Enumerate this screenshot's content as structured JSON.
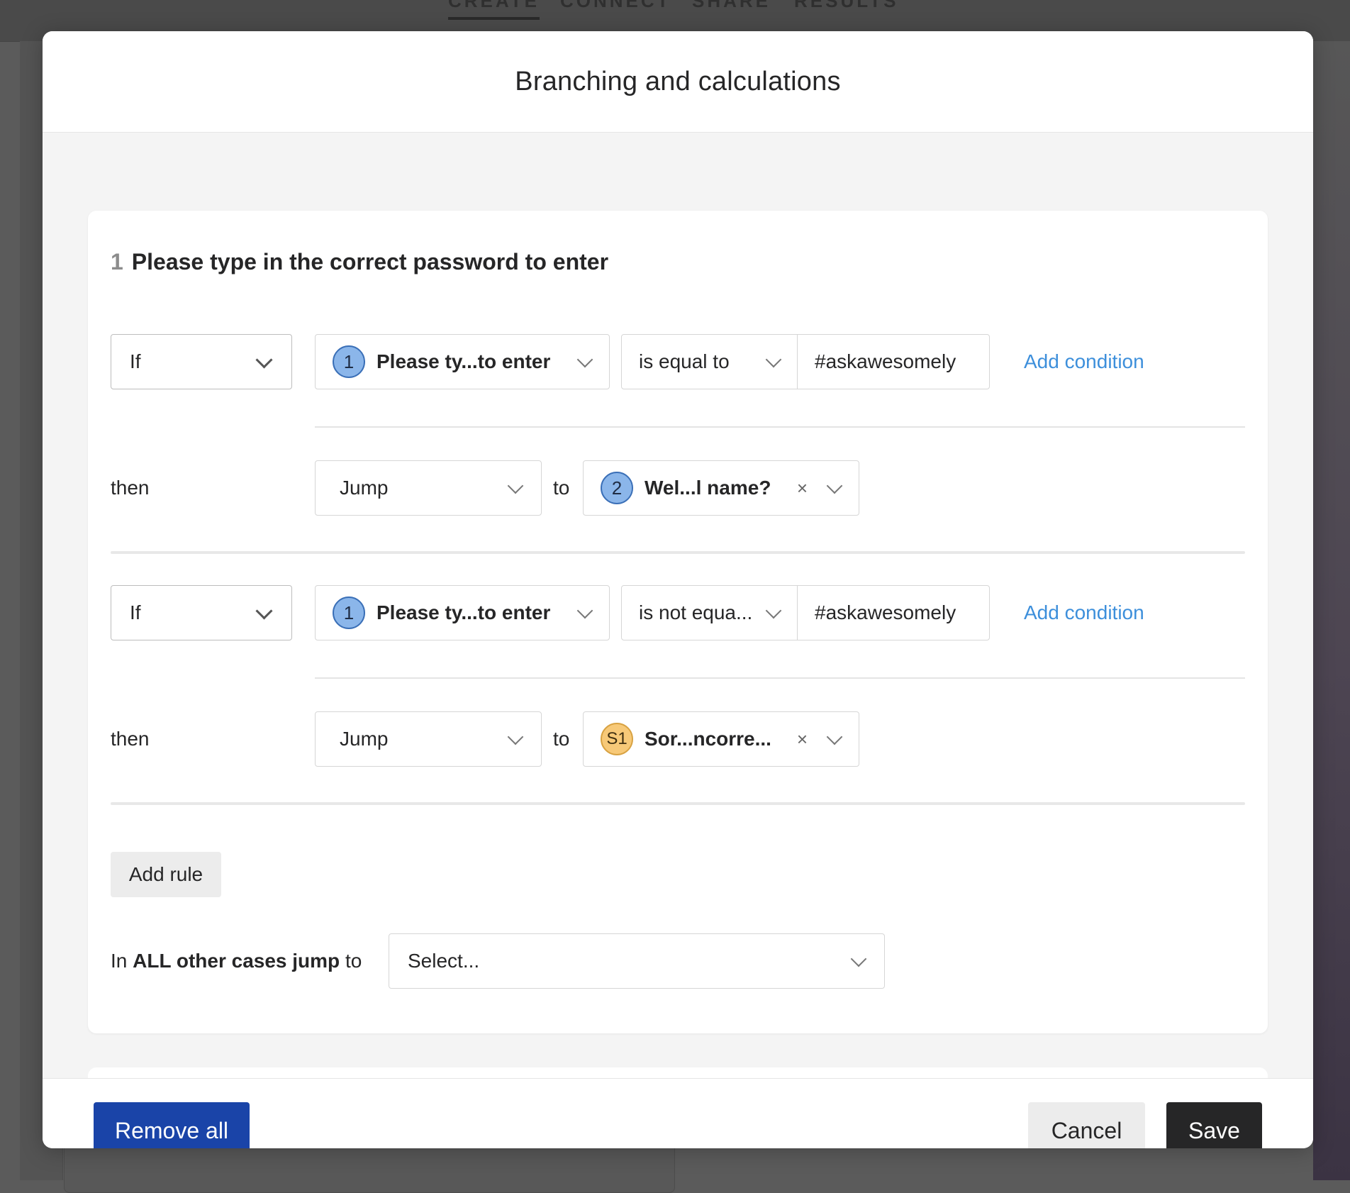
{
  "background": {
    "tabs": [
      "CREATE",
      "CONNECT",
      "SHARE",
      "RESULTS"
    ]
  },
  "modal": {
    "title": "Branching and calculations",
    "question": {
      "number": "1",
      "title": "Please type in the correct password to enter"
    },
    "rules": [
      {
        "condition_type": "If",
        "question_badge": "1",
        "question_label": "Please ty...to enter",
        "operator": "is equal to",
        "value": "#askawesomely",
        "add_condition_label": "Add condition",
        "then_label": "then",
        "action": "Jump",
        "to_label": "to",
        "target_badge": "2",
        "target_label": "Wel...l name?",
        "clear_icon": "×"
      },
      {
        "condition_type": "If",
        "question_badge": "1",
        "question_label": "Please ty...to enter",
        "operator": "is not equa...",
        "value": "#askawesomely",
        "add_condition_label": "Add condition",
        "then_label": "then",
        "action": "Jump",
        "to_label": "to",
        "target_badge": "S1",
        "target_label": "Sor...ncorre...",
        "clear_icon": "×"
      }
    ],
    "add_rule_label": "Add rule",
    "other_cases": {
      "prefix": "In",
      "bold": "ALL other cases jump",
      "suffix": "to",
      "placeholder": "Select..."
    },
    "footer": {
      "remove_all_label": "Remove all",
      "cancel_label": "Cancel",
      "save_label": "Save"
    }
  },
  "colors": {
    "primary_blue": "#1a44a8",
    "link_blue": "#3d8fdb",
    "question_badge": "#8bb6ea",
    "screen_badge": "#f7c978",
    "save_button": "#262627"
  },
  "icons": {
    "dropdown": "chevron-down-icon",
    "clear": "close-icon"
  }
}
